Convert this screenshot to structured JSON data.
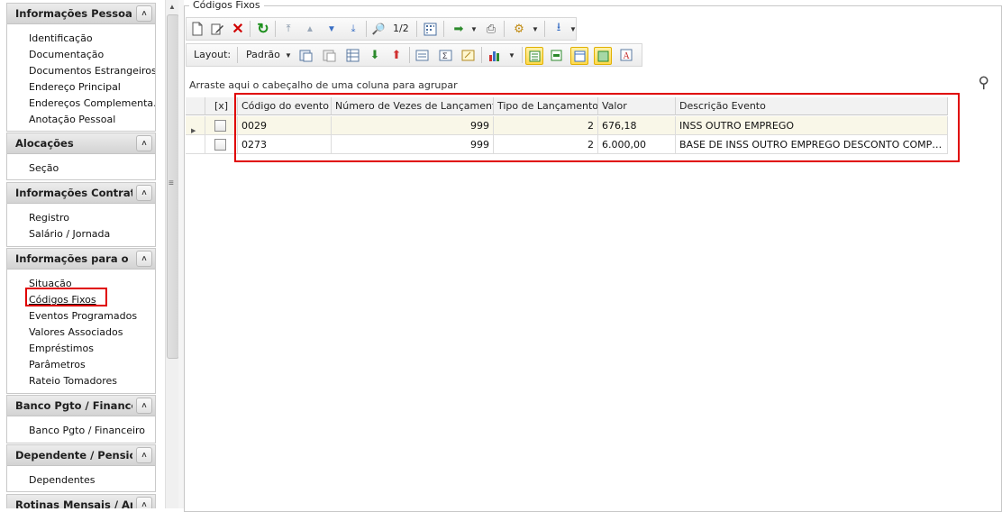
{
  "sidebar": {
    "groups": [
      {
        "title": "Informações Pessoais",
        "items": [
          "Identificação",
          "Documentação",
          "Documentos Estrangeiros",
          "Endereço Principal",
          "Endereços Complementa...",
          "Anotação Pessoal"
        ]
      },
      {
        "title": "Alocações",
        "items": [
          "Seção"
        ]
      },
      {
        "title": "Informações Contratua",
        "items": [
          "Registro",
          "Salário / Jornada"
        ]
      },
      {
        "title": "Informações para o Cál",
        "items": [
          "Situação",
          "Códigos Fixos",
          "Eventos Programados",
          "Valores Associados",
          "Empréstimos",
          "Parâmetros",
          "Rateio Tomadores"
        ]
      },
      {
        "title": "Banco Pgto / Financeiro",
        "items": [
          "Banco Pgto / Financeiro"
        ]
      },
      {
        "title": "Dependente / Pensionis",
        "items": [
          "Dependentes"
        ]
      },
      {
        "title": "Rotinas Mensais / Anua",
        "items": []
      }
    ],
    "active_item": "Códigos Fixos"
  },
  "main": {
    "title": "Códigos Fixos",
    "toolbar": {
      "page_indicator": "1/2",
      "layout_label": "Layout:",
      "layout_value": "Padrão"
    },
    "groupby_hint": "Arraste aqui o cabeçalho de uma coluna para agrupar",
    "grid": {
      "select_all_label": "[x]",
      "columns": [
        "Código do evento",
        "Número de Vezes de Lançamento",
        "Tipo de Lançamento",
        "Valor",
        "Descrição Evento"
      ],
      "rows": [
        {
          "codigo": "0029",
          "vezes": "999",
          "tipo": "2",
          "valor": "676,18",
          "descricao": "INSS OUTRO EMPREGO"
        },
        {
          "codigo": "0273",
          "vezes": "999",
          "tipo": "2",
          "valor": "6.000,00",
          "descricao": "BASE DE INSS OUTRO EMPREGO DESCONTO COMPLEMENT..."
        }
      ]
    }
  },
  "colors": {
    "highlight_red": "#e00000",
    "selected_row": "#f9f7e8",
    "toolbar_active": "#ffd94d"
  }
}
